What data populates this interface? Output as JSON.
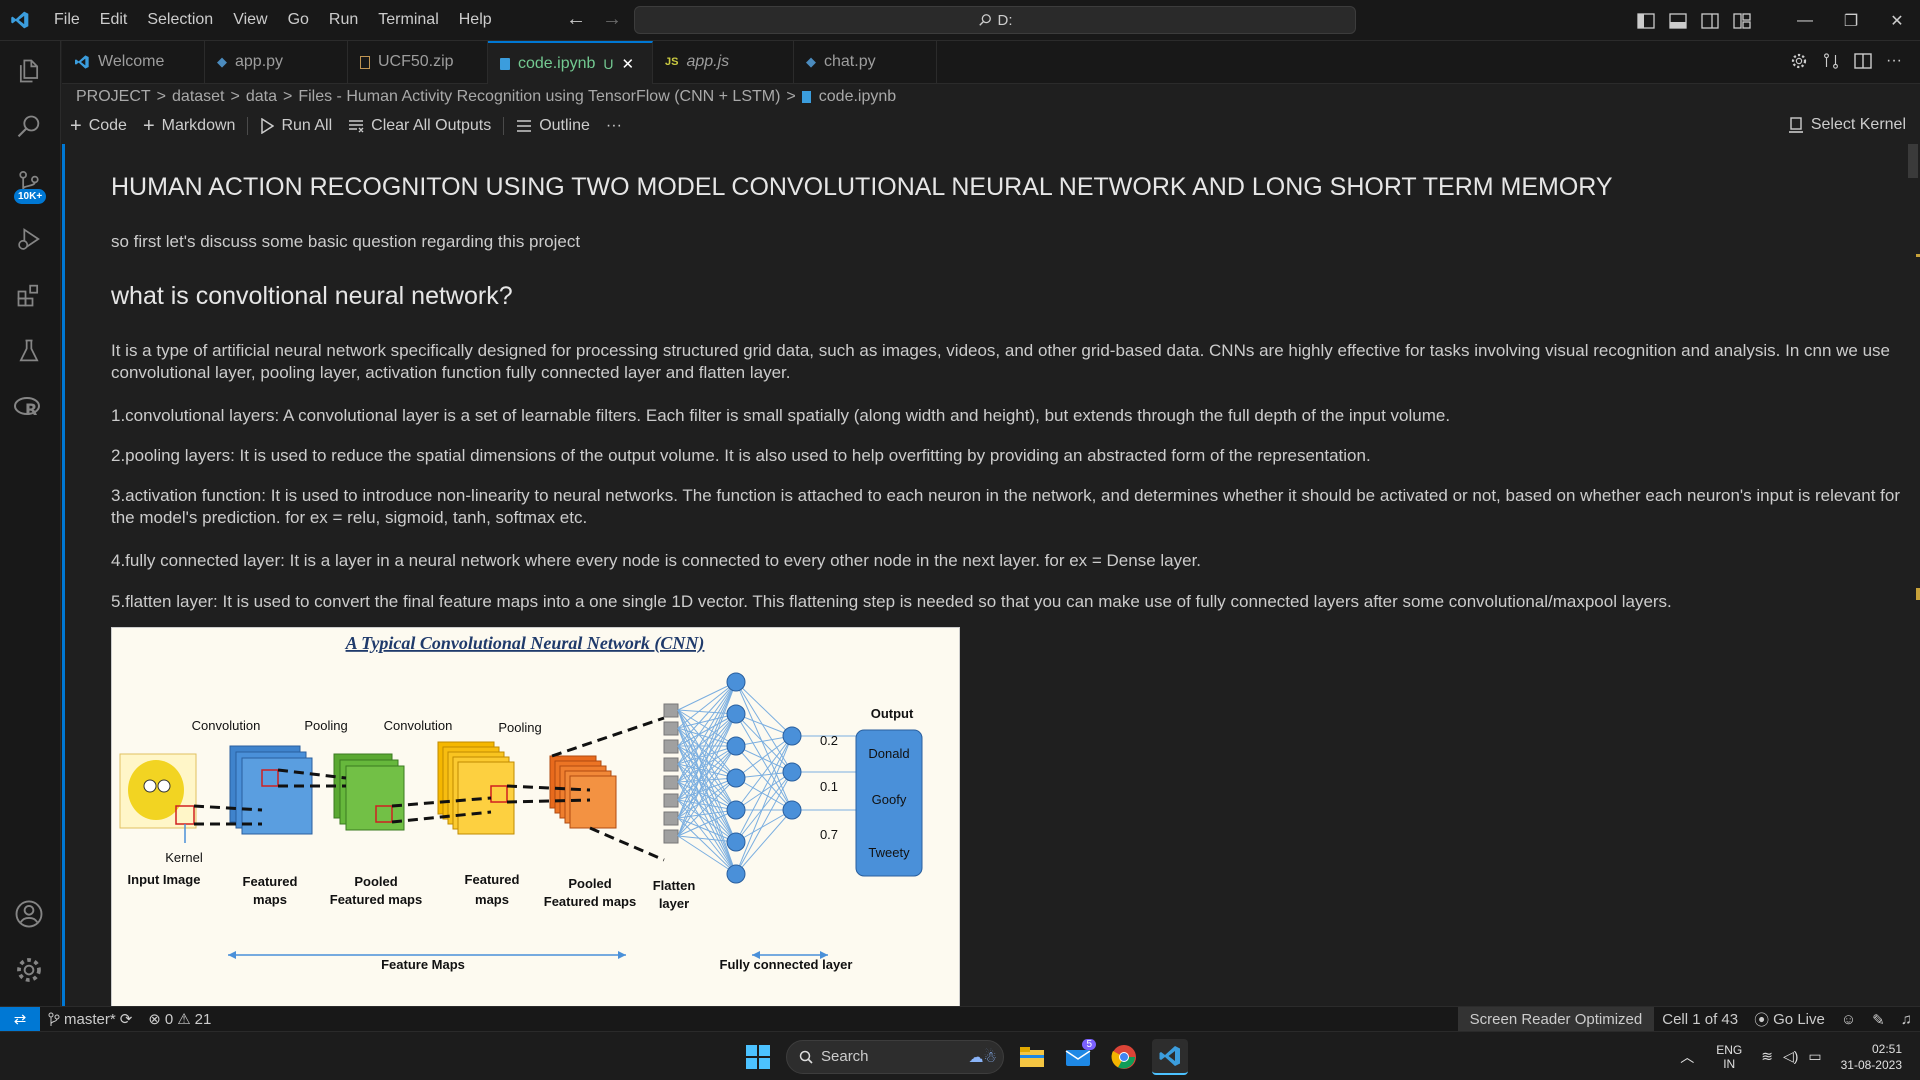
{
  "titlebar": {
    "menu": [
      "File",
      "Edit",
      "Selection",
      "View",
      "Go",
      "Run",
      "Terminal",
      "Help"
    ],
    "search": "D:"
  },
  "activity": {
    "scm_badge": "10K+"
  },
  "tabs": [
    {
      "label": "Welcome",
      "icon": "vscode-icon"
    },
    {
      "label": "app.py",
      "icon": "python-icon"
    },
    {
      "label": "UCF50.zip",
      "icon": "zip-icon"
    },
    {
      "label": "code.ipynb",
      "icon": "notebook-icon",
      "modified": "U",
      "active": true
    },
    {
      "label": "app.js",
      "icon": "js-icon",
      "prefix": "JS"
    },
    {
      "label": "chat.py",
      "icon": "python-icon"
    }
  ],
  "breadcrumb": [
    "PROJECT",
    ">",
    "dataset",
    ">",
    "data",
    ">",
    "Files - Human Activity Recognition using TensorFlow (CNN + LSTM)",
    ">",
    "code.ipynb"
  ],
  "toolbar": {
    "code": "Code",
    "markdown": "Markdown",
    "run_all": "Run All",
    "clear": "Clear All Outputs",
    "outline": "Outline",
    "more": "···",
    "kernel": "Select Kernel"
  },
  "notebook": {
    "title": "HUMAN ACTION RECOGNITON USING TWO MODEL CONVOLUTIONAL NEURAL NETWORK AND LONG SHORT TERM MEMORY",
    "intro": "so first let's discuss some basic question regarding this project",
    "heading": "what is convoltional neural network?",
    "p1": "It is a type of artificial neural network specifically designed for processing structured grid data, such as images, videos, and other grid-based data. CNNs are highly effective for tasks involving visual recognition and analysis. In cnn we use convolutional layer, pooling layer, activation function fully connected layer and flatten layer.",
    "p2": "1.convolutional layers: A convolutional layer is a set of learnable filters. Each filter is small spatially (along width and height), but extends through the full depth of the input volume.",
    "p3": "2.pooling layers: It is used to reduce the spatial dimensions of the output volume. It is also used to help overfitting by providing an abstracted form of the representation.",
    "p4": "3.activation function: It is used to introduce non-linearity to neural networks. The function is attached to each neuron in the network, and determines whether it should be activated or not, based on whether each neuron's input is relevant for the model's prediction. for ex = relu, sigmoid, tanh, softmax etc.",
    "p5": "4.fully connected layer: It is a layer in a neural network where every node is connected to every other node in the next layer. for ex = Dense layer.",
    "p6": "5.flatten layer: It is used to convert the final feature maps into a one single 1D vector. This flattening step is needed so that you can make use of fully connected layers after some convolutional/maxpool layers."
  },
  "diagram": {
    "title": "A Typical Convolutional Neural Network (CNN)",
    "conv1": "Convolution",
    "pool1": "Pooling",
    "conv2": "Convolution",
    "pool2": "Pooling",
    "output": "Output",
    "kernel": "Kernel",
    "input": "Input Image",
    "fm1a": "Featured",
    "fm1b": "maps",
    "pfm1a": "Pooled",
    "pfm1b": "Featured maps",
    "fm2a": "Featured",
    "fm2b": "maps",
    "pfm2a": "Pooled",
    "pfm2b": "Featured maps",
    "flat_a": "Flatten",
    "flat_b": "layer",
    "v1": "0.2",
    "v2": "0.1",
    "v3": "0.7",
    "c1": "Donald",
    "c2": "Goofy",
    "c3": "Tweety",
    "feature_maps": "Feature Maps",
    "fc": "Fully connected layer"
  },
  "status": {
    "branch": "master*",
    "errors": "0",
    "warnings": "21",
    "sr": "Screen Reader Optimized",
    "cell": "Cell 1 of 43",
    "golive": "Go Live"
  },
  "taskbar": {
    "search": "Search",
    "mail_badge": "5",
    "lang1": "ENG",
    "lang2": "IN",
    "time": "02:51",
    "date": "31-08-2023"
  }
}
